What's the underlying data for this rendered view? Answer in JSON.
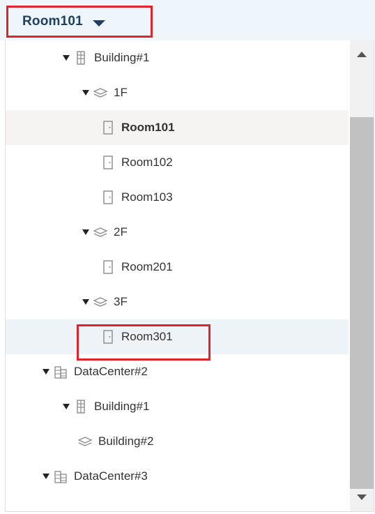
{
  "selector": {
    "label": "Room101"
  },
  "tree": {
    "rows": [
      {
        "label": "Building#1",
        "icon": "building-icon"
      },
      {
        "label": "1F",
        "icon": "floor-layers-icon"
      },
      {
        "label": "Room101",
        "icon": "room-door-icon",
        "selected": true
      },
      {
        "label": "Room102",
        "icon": "room-door-icon"
      },
      {
        "label": "Room103",
        "icon": "room-door-icon"
      },
      {
        "label": "2F",
        "icon": "floor-layers-icon"
      },
      {
        "label": "Room201",
        "icon": "room-door-icon"
      },
      {
        "label": "3F",
        "icon": "floor-layers-icon"
      },
      {
        "label": "Room301",
        "icon": "room-door-icon",
        "highlighted": true
      },
      {
        "label": "DataCenter#2",
        "icon": "datacenter-icon"
      },
      {
        "label": "Building#1",
        "icon": "building-icon"
      },
      {
        "label": "Building#2",
        "icon": "floor-layers-icon"
      },
      {
        "label": "DataCenter#3",
        "icon": "datacenter-icon"
      }
    ]
  },
  "colors": {
    "highlight_border": "#e0242b",
    "selector_text": "#1f3f66",
    "topbar_bg": "#eef6fb"
  }
}
